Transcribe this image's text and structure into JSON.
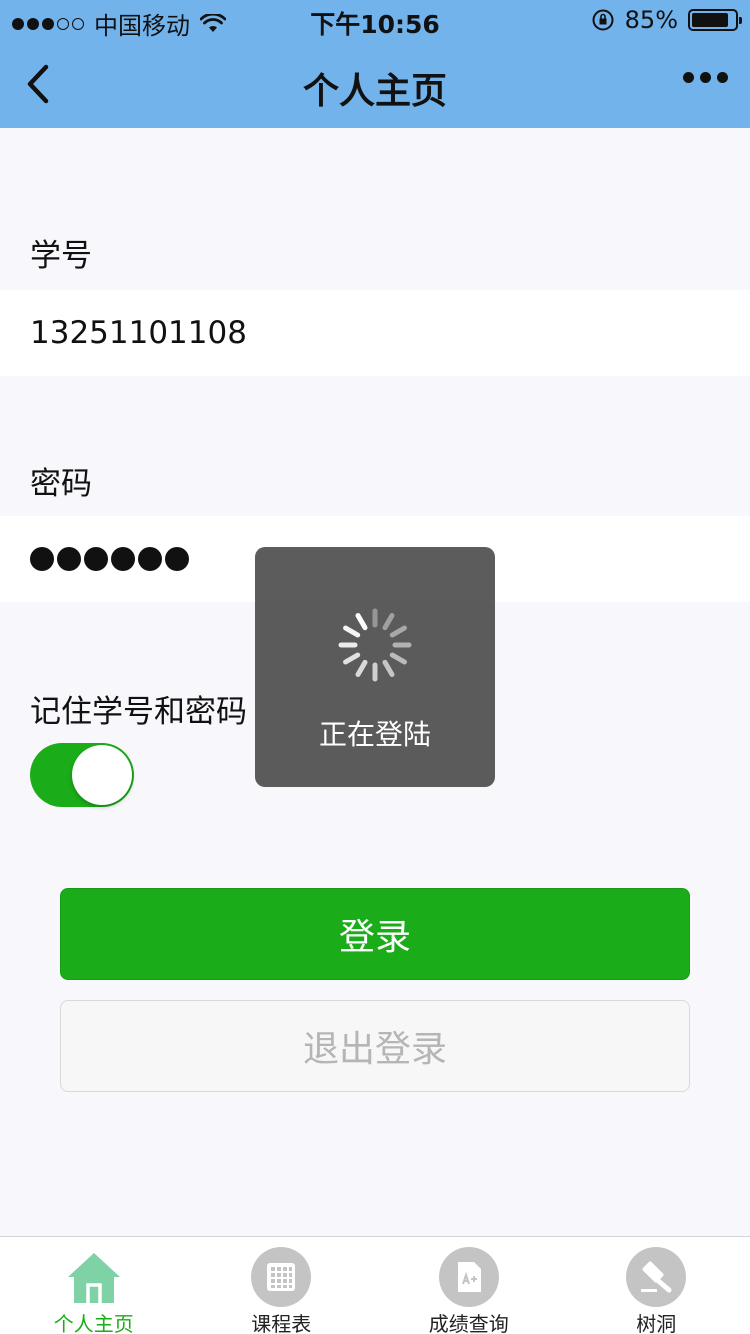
{
  "status_bar": {
    "carrier": "中国移动",
    "time": "下午10:56",
    "battery": "85%",
    "battery_level": 0.85,
    "icons": [
      "signal-dots-icon",
      "wifi-icon",
      "orientation-lock-icon",
      "battery-icon"
    ]
  },
  "nav": {
    "title": "个人主页",
    "back_icon": "chevron-left-icon",
    "more_icon": "more-dots-icon"
  },
  "form": {
    "student_id_label": "学号",
    "student_id_value": "13251101108",
    "password_label": "密码",
    "password_mask_count": 6,
    "remember_label": "记住学号和密码",
    "remember_on": true
  },
  "buttons": {
    "login": "登录",
    "logout": "退出登录"
  },
  "toast": {
    "text": "正在登陆",
    "icon": "loading-spinner-icon"
  },
  "tabbar": {
    "items": [
      {
        "label": "个人主页",
        "icon": "home-icon",
        "active": true
      },
      {
        "label": "课程表",
        "icon": "grid-calendar-icon",
        "active": false
      },
      {
        "label": "成绩查询",
        "icon": "grade-document-icon",
        "active": false
      },
      {
        "label": "树洞",
        "icon": "gavel-icon",
        "active": false
      }
    ]
  },
  "colors": {
    "nav_bg": "#72b3ec",
    "accent_green": "#1aad19",
    "page_bg": "#f8f7fc"
  }
}
